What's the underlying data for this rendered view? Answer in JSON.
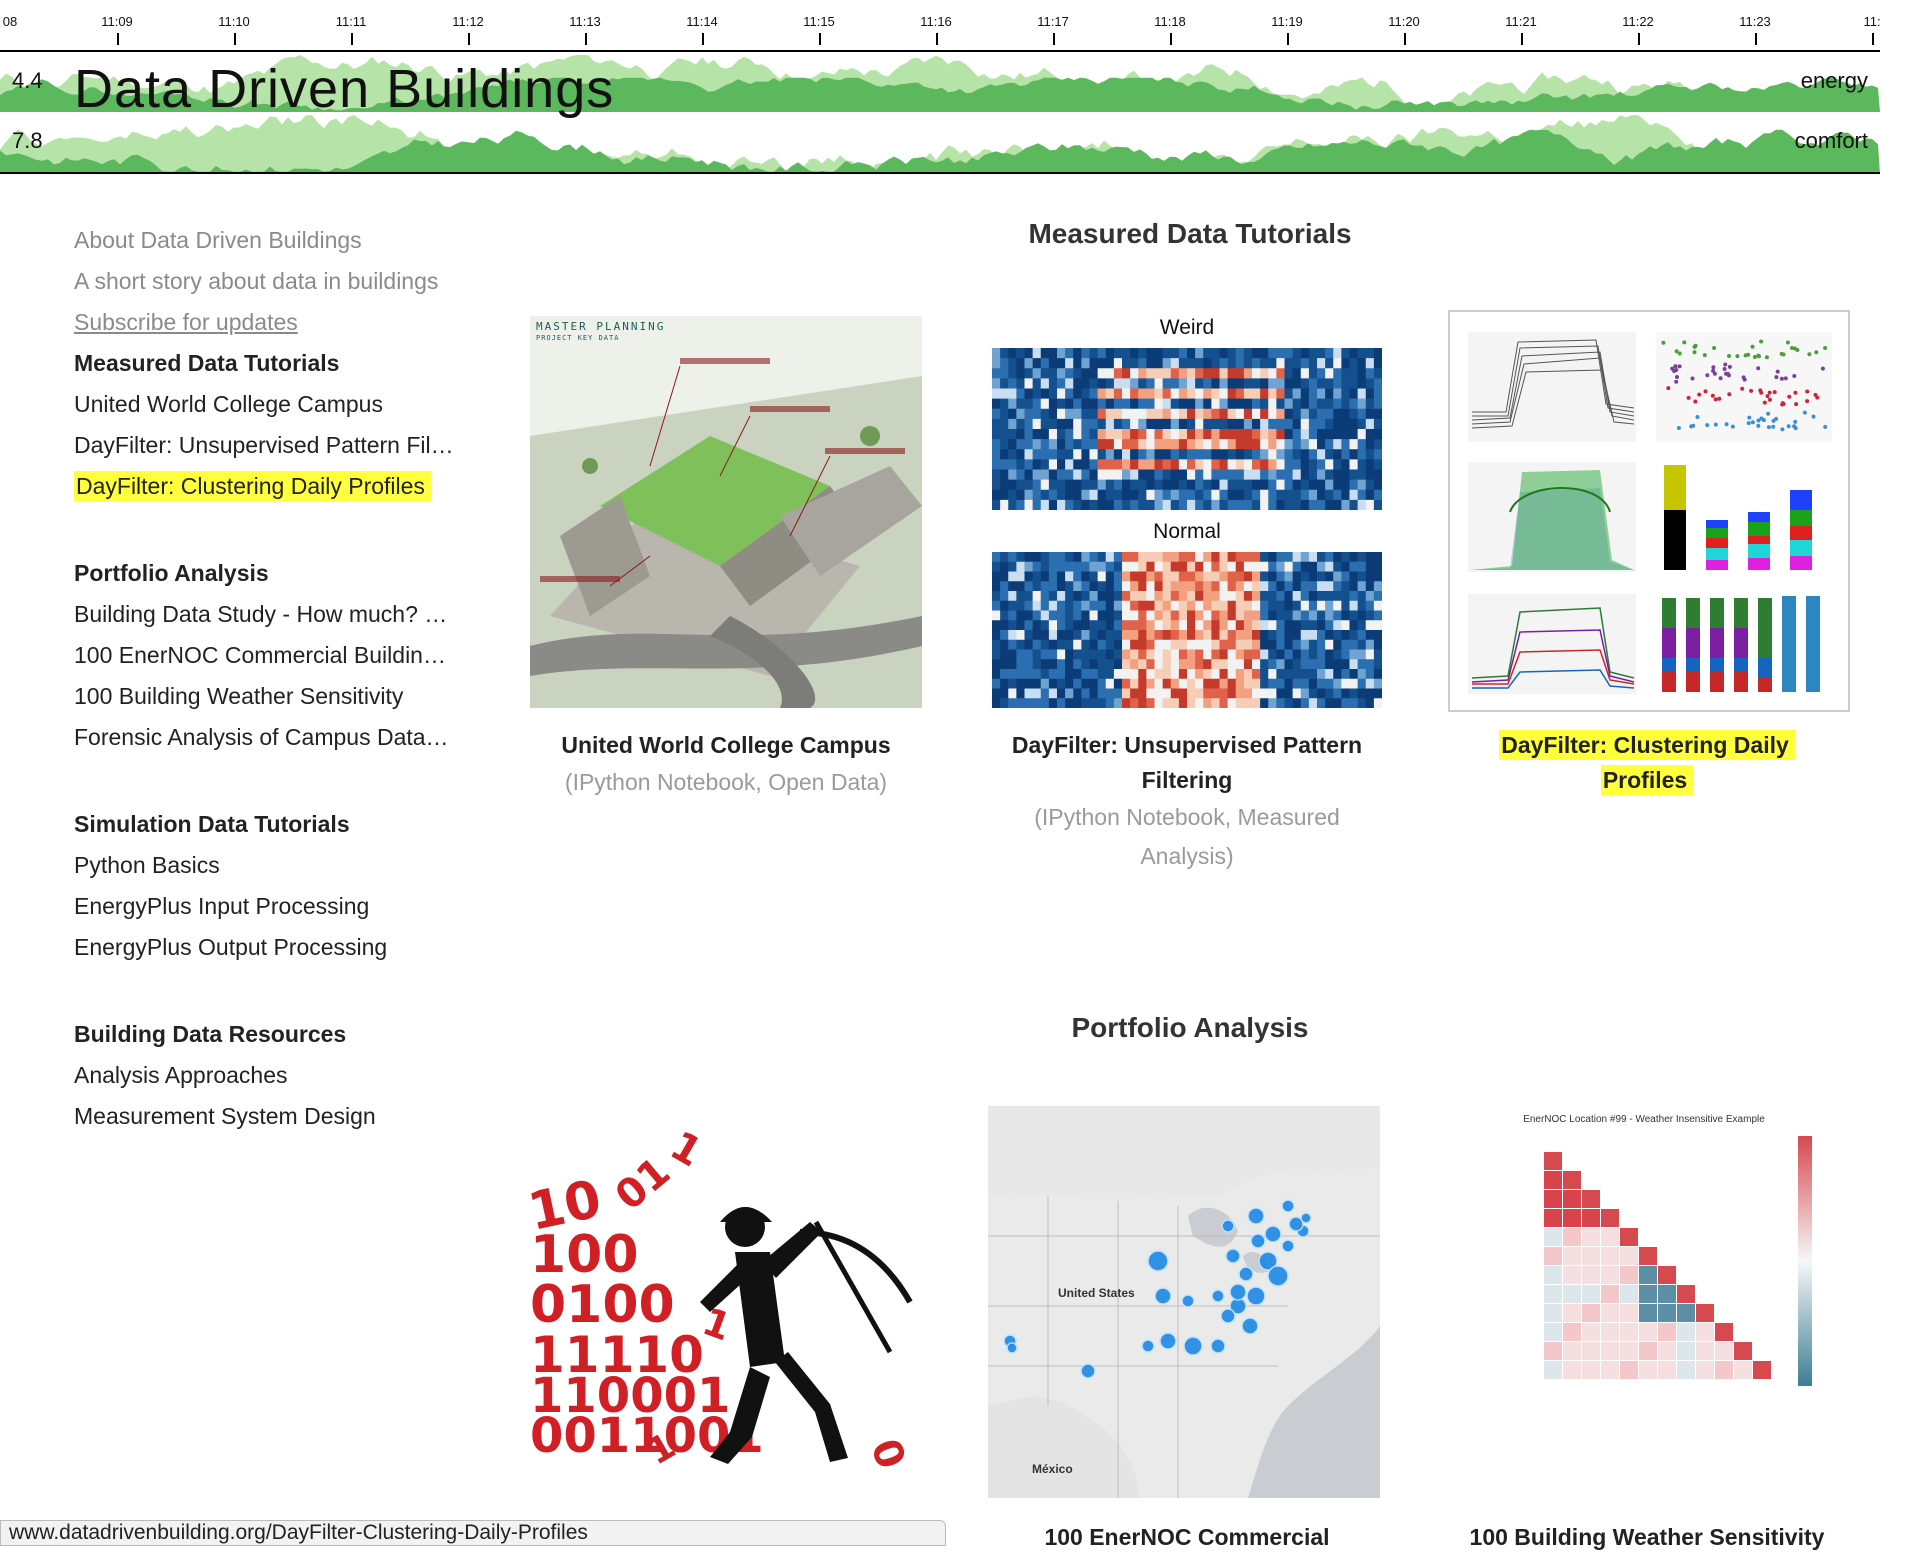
{
  "header": {
    "title": "Data Driven Buildings",
    "ticks": [
      "08",
      "11:09",
      "11:10",
      "11:11",
      "11:12",
      "11:13",
      "11:14",
      "11:15",
      "11:16",
      "11:17",
      "11:18",
      "11:19",
      "11:20",
      "11:21",
      "11:22",
      "11:23",
      "11:"
    ],
    "energy_value": "4.4",
    "energy_label": "energy",
    "comfort_value": "7.8",
    "comfort_label": "comfort",
    "band_color_dark": "#5cb85c",
    "band_color_light": "#b6e3a8"
  },
  "sidebar": {
    "about": "About Data Driven Buildings",
    "story": "A short story about data in buildings",
    "subscribe": "Subscribe for updates",
    "groups": [
      {
        "heading": "Measured Data Tutorials",
        "items": [
          "United World College Campus",
          "DayFilter: Unsupervised Pattern Fil…",
          "DayFilter: Clustering Daily Profiles"
        ]
      },
      {
        "heading": "Portfolio Analysis",
        "items": [
          "Building Data Study - How much? …",
          "100 EnerNOC Commercial Buildin…",
          "100 Building Weather Sensitivity",
          "Forensic Analysis of Campus Data…"
        ]
      },
      {
        "heading": "Simulation Data Tutorials",
        "items": [
          "Python Basics",
          "EnergyPlus Input Processing",
          "EnergyPlus Output Processing"
        ]
      },
      {
        "heading": "Building Data Resources",
        "items": [
          "Analysis Approaches",
          "Measurement System Design"
        ]
      }
    ],
    "highlight_color": "#ffff3c"
  },
  "main": {
    "measured_title": "Measured Data Tutorials",
    "portfolio_title": "Portfolio Analysis",
    "cards": [
      {
        "title": "United World College Campus",
        "subtitle": "(IPython Notebook, Open Data)"
      },
      {
        "title_line1": "DayFilter: Unsupervised Pattern",
        "title_line2": "Filtering",
        "subtitle_line1": "(IPython Notebook, Measured",
        "subtitle_line2": "Analysis)"
      },
      {
        "title_line1": "DayFilter: Clustering Daily",
        "title_line2": "Profiles"
      },
      {
        "title": "100 EnerNOC Commercial"
      },
      {
        "title": "100 Building Weather Sensitivity"
      }
    ],
    "thumb_text": {
      "master_planning": "MASTER PLANNING",
      "project_key_data": "PROJECT KEY DATA",
      "weird": "Weird",
      "normal": "Normal",
      "heatmap_title": "EnerNOC Location #99 - Weather Insensitive Example",
      "map_country": "United States",
      "map_mexico": "México"
    }
  },
  "status_url": "www.datadrivenbuilding.org/DayFilter-Clustering-Daily-Profiles"
}
